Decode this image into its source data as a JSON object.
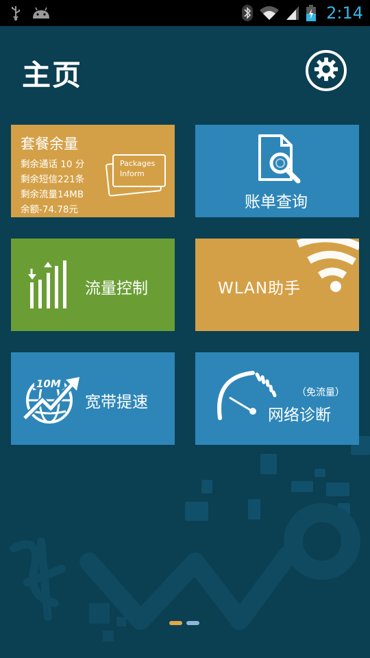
{
  "status_bar": {
    "time": "2:14",
    "icons": [
      "usb-icon",
      "android-icon",
      "bluetooth-icon",
      "wifi-icon",
      "signal-icon",
      "battery-icon"
    ]
  },
  "header": {
    "title": "主页",
    "settings_icon": "gear-icon"
  },
  "tiles": {
    "package": {
      "title": "套餐余量",
      "lines": [
        "剩余通话 10 分",
        "剩余短信221条",
        "剩余流量14MB",
        "余额-74.78元"
      ],
      "card_text_1": "Packages",
      "card_text_2": "Inform",
      "color": "#d4a047"
    },
    "bill": {
      "label": "账单查询",
      "icon": "document-search-icon",
      "color": "#2e86b8"
    },
    "flow": {
      "label": "流量控制",
      "icon": "data-bars-icon",
      "color": "#6a9e35"
    },
    "wlan": {
      "label": "WLAN助手",
      "icon": "wifi-icon",
      "color": "#d4a047"
    },
    "broadband": {
      "label": "宽带提速",
      "icon": "speed-globe-icon",
      "badge": "10M",
      "color": "#2e86b8"
    },
    "diagnose": {
      "label": "网络诊断",
      "sublabel": "（免流量）",
      "icon": "speedometer-icon",
      "color": "#2e86b8"
    }
  },
  "pager": {
    "pages": 2,
    "active": 1
  }
}
